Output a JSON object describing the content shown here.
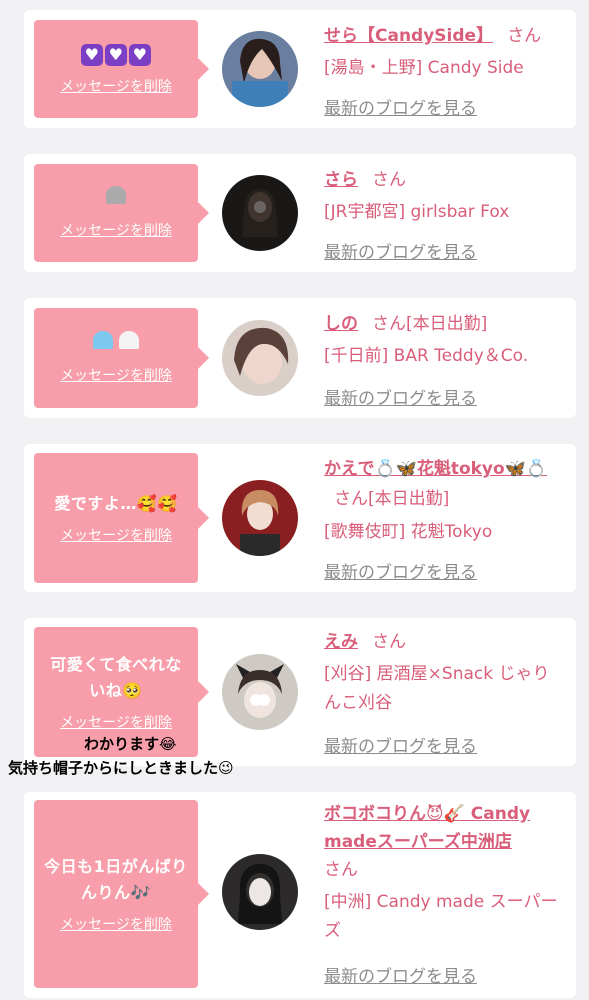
{
  "delete_label": "メッセージを削除",
  "blog_label": "最新のブログを見る",
  "colors": {
    "bubble": "#f79eaa",
    "accent": "#d95e7a",
    "muted": "#8c8c8c",
    "card": "#ffffff",
    "background": "#f1f1f3"
  },
  "cards": [
    {
      "message": "💜💜💜",
      "name": "せら【CandySide】",
      "honorific": "さん",
      "status": "",
      "shop": "[湯島・上野] Candy Side"
    },
    {
      "message": "🩶",
      "name": "さら",
      "honorific": "さん",
      "status": "",
      "shop": "[JR宇都宮] girlsbar Fox"
    },
    {
      "message": "🩵🤍",
      "name": "しの",
      "honorific": "さん",
      "status": "[本日出勤]",
      "shop": "[千日前] BAR Teddy＆Co."
    },
    {
      "message": "愛ですよ…🥰🥰",
      "name": "かえで💍🦋花魁tokyo🦋💍",
      "honorific": "さん",
      "status": "[本日出勤]",
      "shop": "[歌舞伎町] 花魁Tokyo"
    },
    {
      "message": "可愛くて食べれないね🥺",
      "name": "えみ",
      "honorific": "さん",
      "status": "",
      "shop": "[刈谷] 居酒屋×Snack じゃりんこ刈谷"
    },
    {
      "message": "今日も1日がんばりんりん🎶",
      "name": "ボコボコりん😈🎸 Candy madeスーパーズ中洲店",
      "honorific": "さん",
      "status": "",
      "shop": "[中洲] Candy made スーパーズ"
    }
  ],
  "overlay_text": {
    "line1": "わかります😂",
    "line2": "気持ち帽子からにしときました😉"
  }
}
